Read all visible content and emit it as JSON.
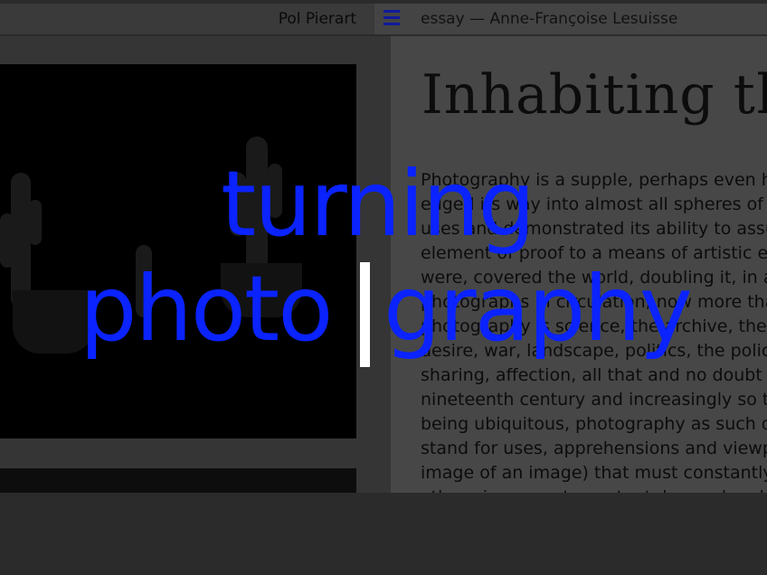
{
  "header": {
    "author": "Pol Pierart",
    "menu_icon": "hamburger-menu-icon",
    "essay_label": "essay — Anne-Françoise Lesuisse"
  },
  "essay": {
    "title": "Inhabiting the",
    "lines": [
      "Photography is a supple, perhaps even hy",
      "edged its way into almost all spheres of hu",
      "uses and demonstrated its ability to assum",
      "element of proof to a means of artistic exp",
      "were, covered the world, doubling it, in a",
      "photographs in circulation, now more than",
      "photography is science, the archive, the o",
      "desire, war, landscape, politics, the police",
      "sharing, affection, all that and no doubt m",
      "nineteenth century and increasingly so to",
      "being ubiquitous, photography as such do",
      "stand for uses, apprehensions and viewpo",
      "image of an image) that must constantly b",
      "other pieces, as to content, beyond and"
    ]
  },
  "overlay": {
    "line1": "turning",
    "line2_left": "photo",
    "line2_right": "graphy",
    "color": "#0a23ff"
  }
}
